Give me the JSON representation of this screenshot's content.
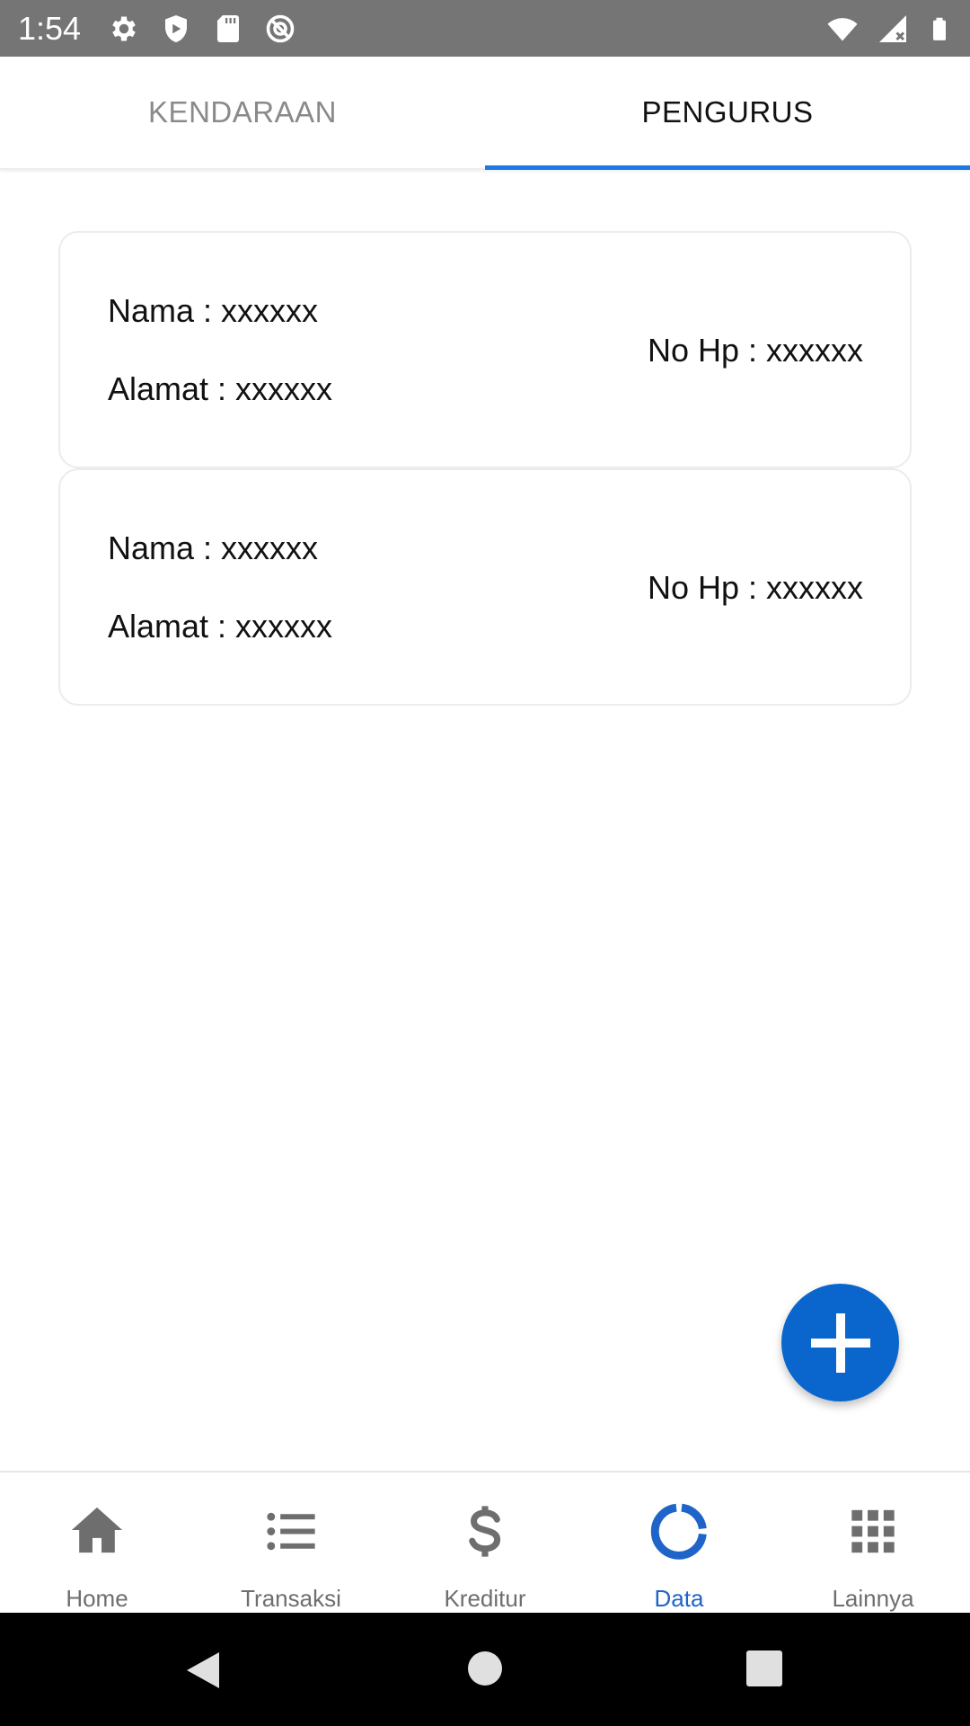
{
  "status_bar": {
    "time": "1:54",
    "left_icons": [
      "gear-icon",
      "shield-icon",
      "sd-card-icon",
      "no-sync-icon"
    ],
    "right_icons": [
      "wifi-icon",
      "signal-icon",
      "battery-icon"
    ]
  },
  "tabs": [
    {
      "label": "KENDARAAN",
      "active": false
    },
    {
      "label": "PENGURUS",
      "active": true
    }
  ],
  "cards": [
    {
      "nama": "Nama : xxxxxx",
      "alamat": "Alamat : xxxxxx",
      "nohp": "No Hp : xxxxxx"
    },
    {
      "nama": "Nama : xxxxxx",
      "alamat": "Alamat : xxxxxx",
      "nohp": "No Hp : xxxxxx"
    }
  ],
  "fab": {
    "icon": "plus-icon",
    "color": "#0a66cc"
  },
  "bottom_nav": {
    "items": [
      {
        "label": "Home",
        "icon": "home-icon"
      },
      {
        "label": "Transaksi",
        "icon": "list-icon"
      },
      {
        "label": "Kreditur",
        "icon": "dollar-icon"
      },
      {
        "label": "Data",
        "icon": "donut-chart-icon",
        "active": true
      },
      {
        "label": "Lainnya",
        "icon": "grid-icon"
      }
    ],
    "active_color": "#1f64c8",
    "inactive_color": "#6e6e6e"
  },
  "system_nav": [
    "back-icon",
    "home-circle-icon",
    "recents-icon"
  ]
}
